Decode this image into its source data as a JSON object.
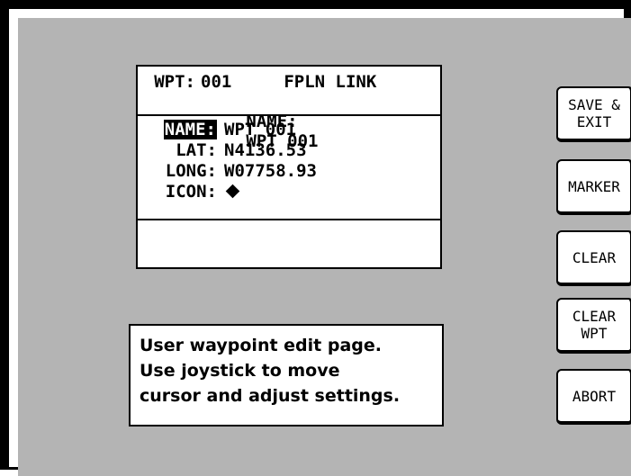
{
  "waypoint_panel": {
    "header": {
      "wpt_label": "WPT:",
      "wpt_value": "001",
      "mode_label": "FPLN LINK",
      "name_label": "NAME:",
      "name_value": "WPT 001"
    },
    "fields": {
      "name": {
        "label": "NAME:",
        "value": "WPT 001"
      },
      "lat": {
        "label": "LAT:",
        "value": "N4136.53"
      },
      "long": {
        "label": "LONG:",
        "value": "W07758.93"
      },
      "icon": {
        "label": "ICON:",
        "value": "diamond-icon"
      }
    }
  },
  "help_text": {
    "line1": "User waypoint edit page.",
    "line2": "Use joystick to move",
    "line3": "cursor and adjust settings."
  },
  "softkeys": [
    {
      "line1": "SAVE &",
      "line2": "EXIT"
    },
    {
      "line1": "MARKER",
      "line2": ""
    },
    {
      "line1": "CLEAR",
      "line2": ""
    },
    {
      "line1": "CLEAR",
      "line2": "WPT"
    },
    {
      "line1": "ABORT",
      "line2": ""
    }
  ],
  "colors": {
    "screen_background": "#b4b4b4",
    "panel_background": "#ffffff",
    "text": "#000000"
  }
}
